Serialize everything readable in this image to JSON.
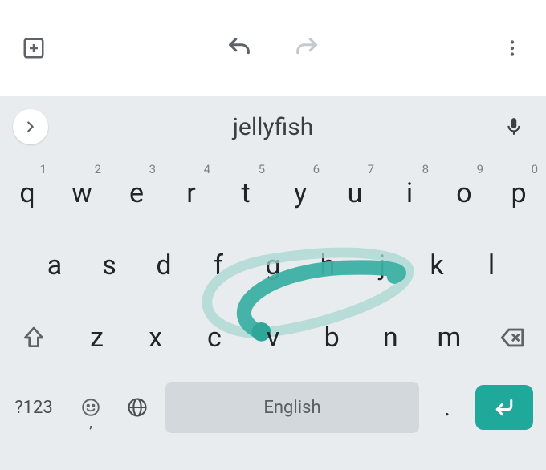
{
  "suggestion": {
    "word": "jellyfish"
  },
  "rows": {
    "r1": [
      {
        "ch": "q",
        "n": "1"
      },
      {
        "ch": "w",
        "n": "2"
      },
      {
        "ch": "e",
        "n": "3"
      },
      {
        "ch": "r",
        "n": "4"
      },
      {
        "ch": "t",
        "n": "5"
      },
      {
        "ch": "y",
        "n": "6"
      },
      {
        "ch": "u",
        "n": "7"
      },
      {
        "ch": "i",
        "n": "8"
      },
      {
        "ch": "o",
        "n": "9"
      },
      {
        "ch": "p",
        "n": "0"
      }
    ],
    "r2": [
      {
        "ch": "a"
      },
      {
        "ch": "s"
      },
      {
        "ch": "d"
      },
      {
        "ch": "f"
      },
      {
        "ch": "g"
      },
      {
        "ch": "h"
      },
      {
        "ch": "j"
      },
      {
        "ch": "k"
      },
      {
        "ch": "l"
      }
    ],
    "r3": [
      {
        "ch": "z"
      },
      {
        "ch": "x"
      },
      {
        "ch": "c"
      },
      {
        "ch": "v"
      },
      {
        "ch": "b"
      },
      {
        "ch": "n"
      },
      {
        "ch": "m"
      }
    ]
  },
  "bottom": {
    "symbols": "?123",
    "comma": ",",
    "space": "English",
    "dot": "."
  },
  "colors": {
    "accent": "#1fa99a",
    "trail_dark": "#34a99a",
    "trail_light": "#a8d7cf"
  }
}
